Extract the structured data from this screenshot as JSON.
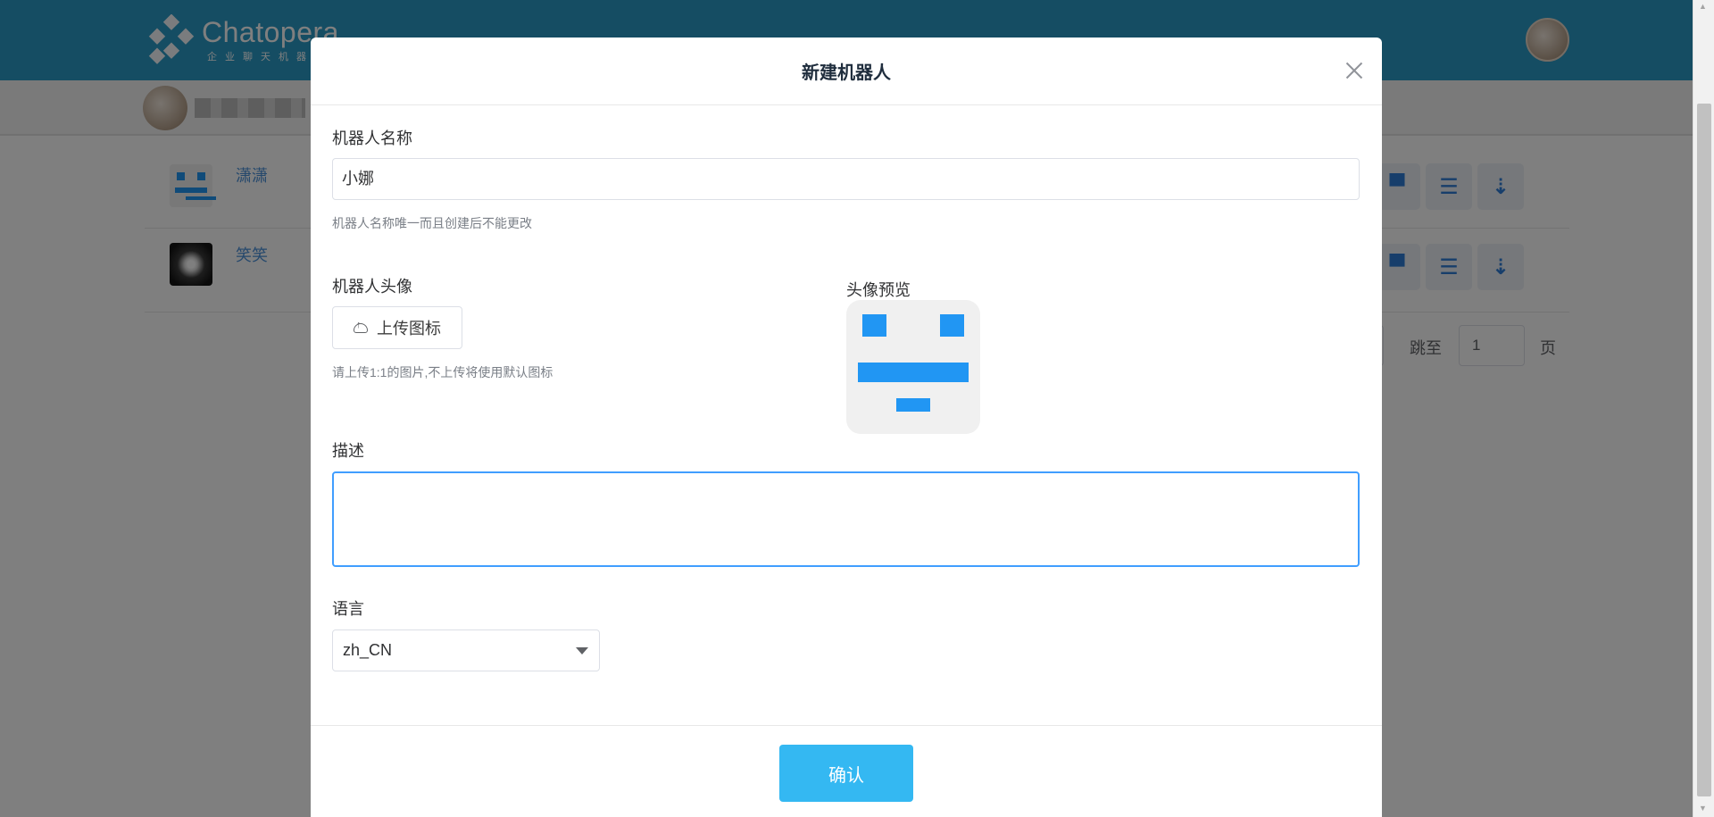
{
  "app": {
    "brand": "Chatopera",
    "brand_sub": "企业聊天机器"
  },
  "bots": [
    {
      "name": "潇潇",
      "icon": "robot-avatar-icon"
    },
    {
      "name": "笑笑",
      "icon": "flower-avatar-icon"
    }
  ],
  "pager": {
    "goto_label": "跳至",
    "page_value": "1",
    "page_suffix": "页"
  },
  "modal": {
    "title": "新建机器人",
    "name_label": "机器人名称",
    "name_value": "小娜",
    "name_hint": "机器人名称唯一而且创建后不能更改",
    "avatar_label": "机器人头像",
    "upload_label": "上传图标",
    "upload_hint": "请上传1:1的图片,不上传将使用默认图标",
    "preview_label": "头像预览",
    "desc_label": "描述",
    "desc_value": "",
    "lang_label": "语言",
    "lang_value": "zh_CN",
    "confirm_label": "确认"
  },
  "colors": {
    "header": "#2a9bc7",
    "primary": "#34b8f2",
    "focus": "#409eff",
    "avatar_blue": "#2196f3"
  }
}
